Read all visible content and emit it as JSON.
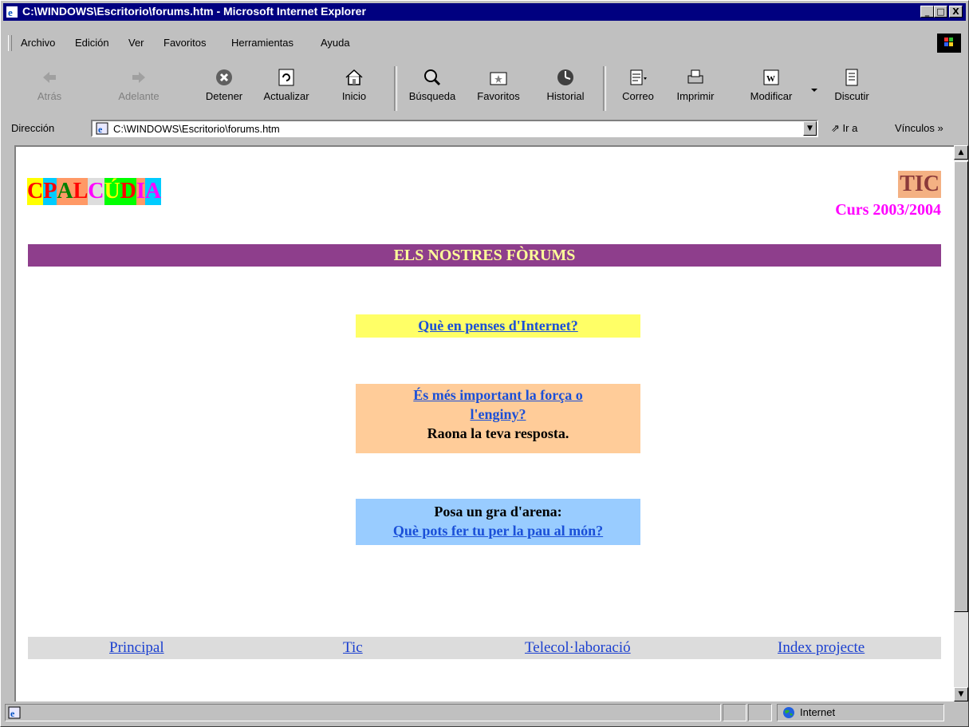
{
  "window": {
    "title": "C:\\WINDOWS\\Escritorio\\forums.htm - Microsoft Internet Explorer",
    "minimize": "_",
    "maximize": "□",
    "close": "X"
  },
  "menu": [
    "Archivo",
    "Edición",
    "Ver",
    "Favoritos",
    "Herramientas",
    "Ayuda"
  ],
  "toolbar": {
    "back": "Atrás",
    "forward": "Adelante",
    "stop": "Detener",
    "refresh": "Actualizar",
    "home": "Inicio",
    "search": "Búsqueda",
    "favorites": "Favoritos",
    "history": "Historial",
    "mail": "Correo",
    "print": "Imprimir",
    "edit": "Modificar",
    "discuss": "Discutir"
  },
  "address": {
    "label": "Dirección",
    "value": "C:\\WINDOWS\\Escritorio\\forums.htm",
    "go": "Ir a",
    "links": "Vínculos"
  },
  "page": {
    "logo_letters": [
      {
        "t": "C",
        "bg": "#ffff00",
        "fg": "#ff0000"
      },
      {
        "t": "P",
        "bg": "#00ccff",
        "fg": "#ff0000"
      },
      {
        "t": " ",
        "bg": "#ffffff",
        "fg": "#000000"
      },
      {
        "t": "A",
        "bg": "#ff9966",
        "fg": "#008000"
      },
      {
        "t": "L",
        "bg": "#ff9966",
        "fg": "#ff0000"
      },
      {
        "t": "C",
        "bg": "#dddddd",
        "fg": "#ff00ff"
      },
      {
        "t": "Ú",
        "bg": "#00ff00",
        "fg": "#ffff00"
      },
      {
        "t": "D",
        "bg": "#00ff00",
        "fg": "#ff0000"
      },
      {
        "t": "I",
        "bg": "#ff9966",
        "fg": "#ff00ff"
      },
      {
        "t": "A",
        "bg": "#00ccff",
        "fg": "#ff00ff"
      }
    ],
    "tic": "TIC",
    "curs": "Curs 2003/2004",
    "banner": "ELS NOSTRES FÒRUMS",
    "forum1": {
      "link": "Què en penses d'Internet?",
      "bg": "#ffff66"
    },
    "forum2": {
      "link_line1": "És més important la força o",
      "link_line2": "l'enginy?",
      "text": "Raona la teva resposta.",
      "bg": "#ffcc99"
    },
    "forum3": {
      "text": "Posa un gra d'arena:",
      "link": "Què pots fer tu per la pau al món?",
      "bg": "#99ccff"
    },
    "footer": [
      "Principal",
      "Tic",
      "Telecol·laboració",
      "Index projecte"
    ]
  },
  "status": {
    "zone": "Internet"
  }
}
